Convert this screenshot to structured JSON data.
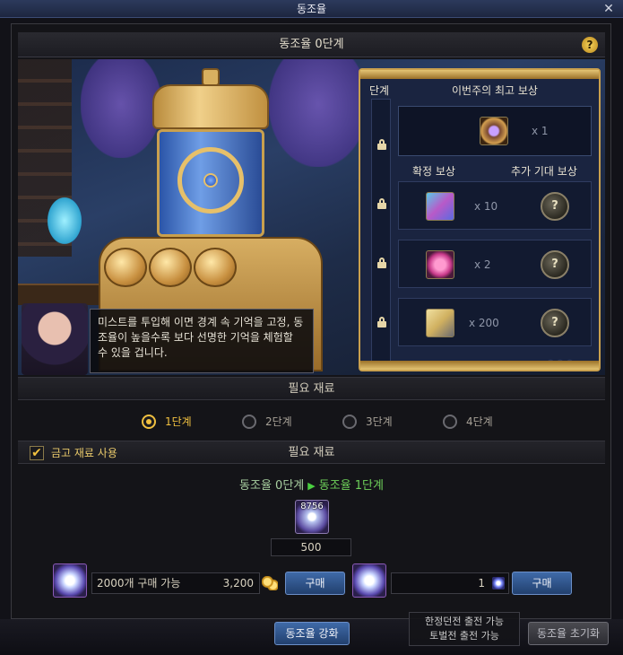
{
  "window": {
    "title": "동조율"
  },
  "panel": {
    "title": "동조율 0단계"
  },
  "dialog_text": "미스트를 투입해 이면 경계 속 기억을 고정, 동조율이 높을수록 보다 선명한 기억을 체험할 수 있을 겁니다.",
  "rewards": {
    "stage_col_label": "단계",
    "best_title": "이번주의 최고 보상",
    "best_qty": "x 1",
    "fixed_label": "확정 보상",
    "extra_label": "추가 기대 보상",
    "rows": [
      {
        "qty": "x 10",
        "bonus_glyph": "?"
      },
      {
        "qty": "x 2",
        "bonus_glyph": "?"
      },
      {
        "qty": "x 200",
        "bonus_glyph": "?"
      }
    ]
  },
  "materials": {
    "section_title": "필요 재료",
    "options": [
      "1단계",
      "2단계",
      "3단계",
      "4단계"
    ],
    "selected_index": 0,
    "vault_checkbox_label": "금고 재료 사용",
    "vault_checked": true,
    "section_title_2": "필요 재료",
    "stage_from": "동조율 0단계",
    "stage_to": "동조율 1단계",
    "material_count": "8756",
    "required_amount": "500"
  },
  "shop": {
    "left_field_text": "2000개 구매 가능",
    "left_price": "3,200",
    "buy_label": "구매",
    "right_quantity": "1",
    "buy_label_2": "구매"
  },
  "footer": {
    "enhance_button": "동조율 강화",
    "note_line1": "한정던전 출전 가능",
    "note_line2": "토벌전 출전 가능",
    "reset_button": "동조율 초기화"
  },
  "colors": {
    "accent_gold": "#f0c040",
    "button_blue": "#3f6aa8",
    "stage_green": "#6ed05a"
  }
}
